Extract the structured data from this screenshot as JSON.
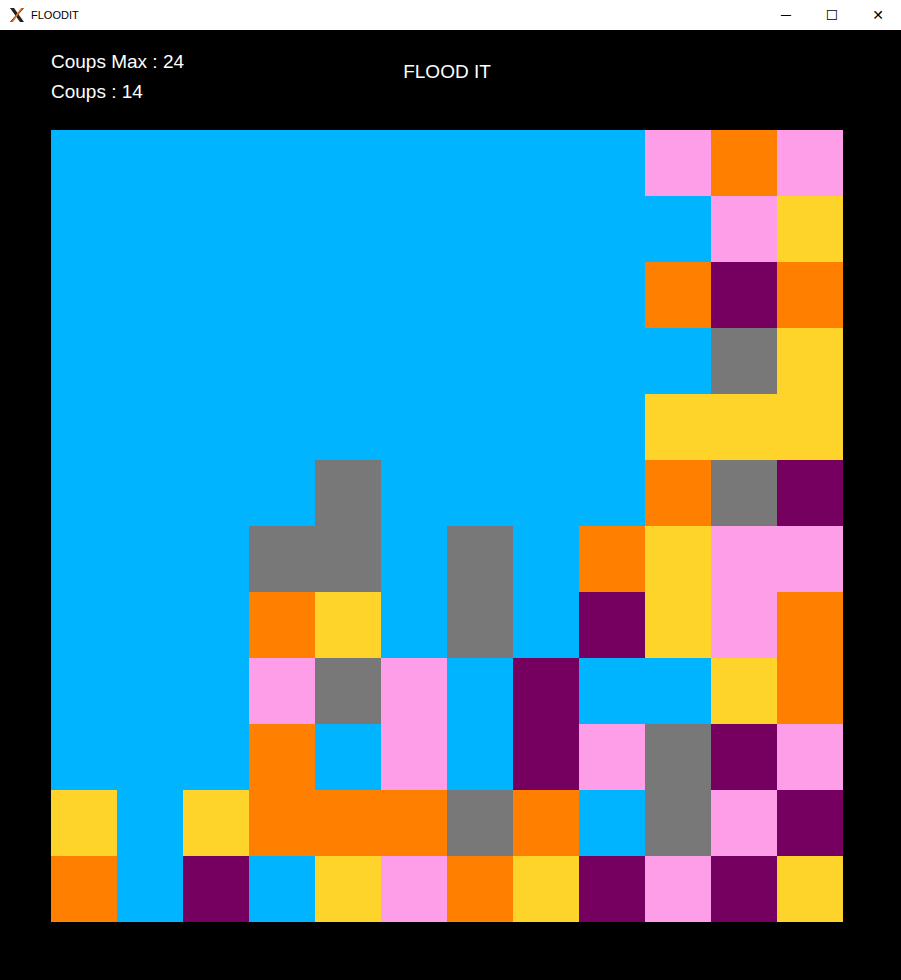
{
  "window": {
    "title": "FLOODIT",
    "controls": [
      "─",
      "☐",
      "✕"
    ]
  },
  "stats": [
    {
      "label": "Coups Max : 24"
    },
    {
      "label": "Coups : 14"
    }
  ],
  "game_title": "FLOOD IT",
  "board": {
    "rows": [
      [
        "#00b4ff",
        "#00b4ff",
        "#00b4ff",
        "#00b4ff",
        "#00b4ff",
        "#00b4ff",
        "#00b4ff",
        "#00b4ff",
        "#00b4ff",
        "#ff9ee8",
        "#ff8000",
        "#ff9ee8"
      ],
      [
        "#00b4ff",
        "#00b4ff",
        "#00b4ff",
        "#00b4ff",
        "#00b4ff",
        "#00b4ff",
        "#00b4ff",
        "#00b4ff",
        "#00b4ff",
        "#00b4ff",
        "#ff9ee8",
        "#ffd42a"
      ],
      [
        "#00b4ff",
        "#00b4ff",
        "#00b4ff",
        "#00b4ff",
        "#00b4ff",
        "#00b4ff",
        "#00b4ff",
        "#00b4ff",
        "#00b4ff",
        "#ff8000",
        "#760060",
        "#ff8000"
      ],
      [
        "#00b4ff",
        "#00b4ff",
        "#00b4ff",
        "#00b4ff",
        "#00b4ff",
        "#00b4ff",
        "#00b4ff",
        "#00b4ff",
        "#00b4ff",
        "#00b4ff",
        "#787878",
        "#ffd42a"
      ],
      [
        "#00b4ff",
        "#00b4ff",
        "#00b4ff",
        "#00b4ff",
        "#00b4ff",
        "#00b4ff",
        "#00b4ff",
        "#00b4ff",
        "#00b4ff",
        "#ffd42a",
        "#ffd42a",
        "#ffd42a"
      ],
      [
        "#00b4ff",
        "#00b4ff",
        "#00b4ff",
        "#00b4ff",
        "#787878",
        "#00b4ff",
        "#00b4ff",
        "#00b4ff",
        "#00b4ff",
        "#ff8000",
        "#787878",
        "#760060"
      ],
      [
        "#00b4ff",
        "#00b4ff",
        "#00b4ff",
        "#787878",
        "#787878",
        "#00b4ff",
        "#787878",
        "#00b4ff",
        "#ff8000",
        "#ffd42a",
        "#ff9ee8",
        "#ff9ee8"
      ],
      [
        "#00b4ff",
        "#00b4ff",
        "#00b4ff",
        "#ff8000",
        "#ffd42a",
        "#00b4ff",
        "#787878",
        "#00b4ff",
        "#760060",
        "#ffd42a",
        "#ff9ee8",
        "#ff8000"
      ],
      [
        "#00b4ff",
        "#00b4ff",
        "#00b4ff",
        "#ff9ee8",
        "#787878",
        "#ff9ee8",
        "#00b4ff",
        "#760060",
        "#00b4ff",
        "#00b4ff",
        "#ffd42a",
        "#ff8000"
      ],
      [
        "#00b4ff",
        "#00b4ff",
        "#00b4ff",
        "#ff8000",
        "#00b4ff",
        "#ff9ee8",
        "#00b4ff",
        "#760060",
        "#ff9ee8",
        "#787878",
        "#760060",
        "#ff9ee8"
      ],
      [
        "#ffd42a",
        "#00b4ff",
        "#ffd42a",
        "#ff8000",
        "#ff8000",
        "#ff8000",
        "#787878",
        "#ff8000",
        "#00b4ff",
        "#787878",
        "#ff9ee8",
        "#760060"
      ],
      [
        "#ff8000",
        "#00b4ff",
        "#760060",
        "#00b4ff",
        "#ffd42a",
        "#ff9ee8",
        "#ff8000",
        "#ffd42a",
        "#760060",
        "#ff9ee8",
        "#760060",
        "#ffd42a"
      ]
    ]
  }
}
